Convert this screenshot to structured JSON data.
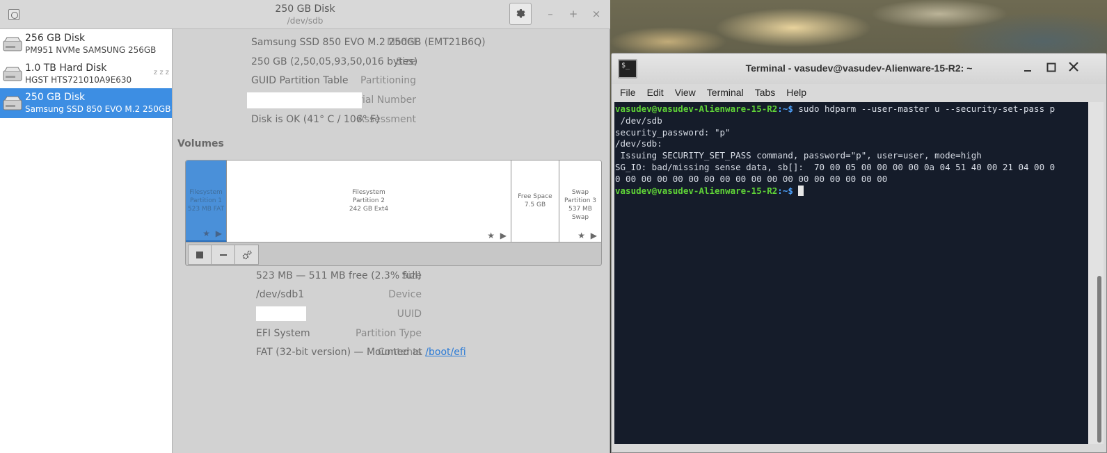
{
  "disks_window": {
    "title": "250 GB Disk",
    "subtitle": "/dev/sdb",
    "wm": {
      "minimize": "–",
      "maximize": "+",
      "close": "×"
    }
  },
  "sidebar": {
    "items": [
      {
        "name": "256 GB Disk",
        "model": "PM951 NVMe SAMSUNG 256GB",
        "selected": false
      },
      {
        "name": "1.0 TB Hard Disk",
        "model": "HGST HTS721010A9E630",
        "selected": false,
        "status": "z z z"
      },
      {
        "name": "250 GB Disk",
        "model": "Samsung SSD 850 EVO M.2 250GB",
        "selected": true
      }
    ]
  },
  "drive_info": {
    "model_label": "Model",
    "model": "Samsung SSD 850 EVO M.2 250GB (EMT21B6Q)",
    "size_label": "Size",
    "size": "250 GB (2,50,05,93,50,016 bytes)",
    "partitioning_label": "Partitioning",
    "partitioning": "GUID Partition Table",
    "serial_label": "Serial Number",
    "serial": "",
    "assessment_label": "Assessment",
    "assessment": "Disk is OK (41° C / 106° F)"
  },
  "volumes": {
    "heading": "Volumes",
    "segments": [
      {
        "line1": "Filesystem",
        "line2": "Partition 1",
        "line3": "523 MB FAT",
        "selected": true
      },
      {
        "line1": "Filesystem",
        "line2": "Partition 2",
        "line3": "242 GB Ext4",
        "selected": false
      },
      {
        "line1": "Free Space",
        "line2": "7.5 GB",
        "line3": "",
        "selected": false
      },
      {
        "line1": "Swap",
        "line2": "Partition 3",
        "line3": "537 MB Swap",
        "selected": false
      }
    ],
    "marks": "★ ▶"
  },
  "partition_info": {
    "size_label": "Size",
    "size": "523 MB — 511 MB free (2.3% full)",
    "device_label": "Device",
    "device": "/dev/sdb1",
    "uuid_label": "UUID",
    "uuid": "",
    "type_label": "Partition Type",
    "type": "EFI System",
    "contents_label": "Contents",
    "contents_prefix": "FAT (32-bit version) — Mounted at ",
    "mount_link": "/boot/efi"
  },
  "terminal": {
    "title": "Terminal - vasudev@vasudev-Alienware-15-R2: ~",
    "icon_text": "$_",
    "menu": [
      "File",
      "Edit",
      "View",
      "Terminal",
      "Tabs",
      "Help"
    ],
    "prompt_user": "vasudev@vasudev-Alienware-15-R2",
    "prompt_path": ":~$",
    "command": " sudo hdparm --user-master u --security-set-pass p",
    "lines": [
      " /dev/sdb",
      "security_password: \"p\"",
      "",
      "/dev/sdb:",
      " Issuing SECURITY_SET_PASS command, password=\"p\", user=user, mode=high",
      "SG_IO: bad/missing sense data, sb[]:  70 00 05 00 00 00 00 0a 04 51 40 00 21 04 00 0",
      "0 00 00 00 00 00 00 00 00 00 00 00 00 00 00 00 00 00"
    ]
  },
  "colors": {
    "selection": "#3d8ee3",
    "terminal_bg": "#151c2a",
    "prompt_user": "#5fd337",
    "prompt_path": "#4ea3ff",
    "link": "#2a7ad6"
  }
}
